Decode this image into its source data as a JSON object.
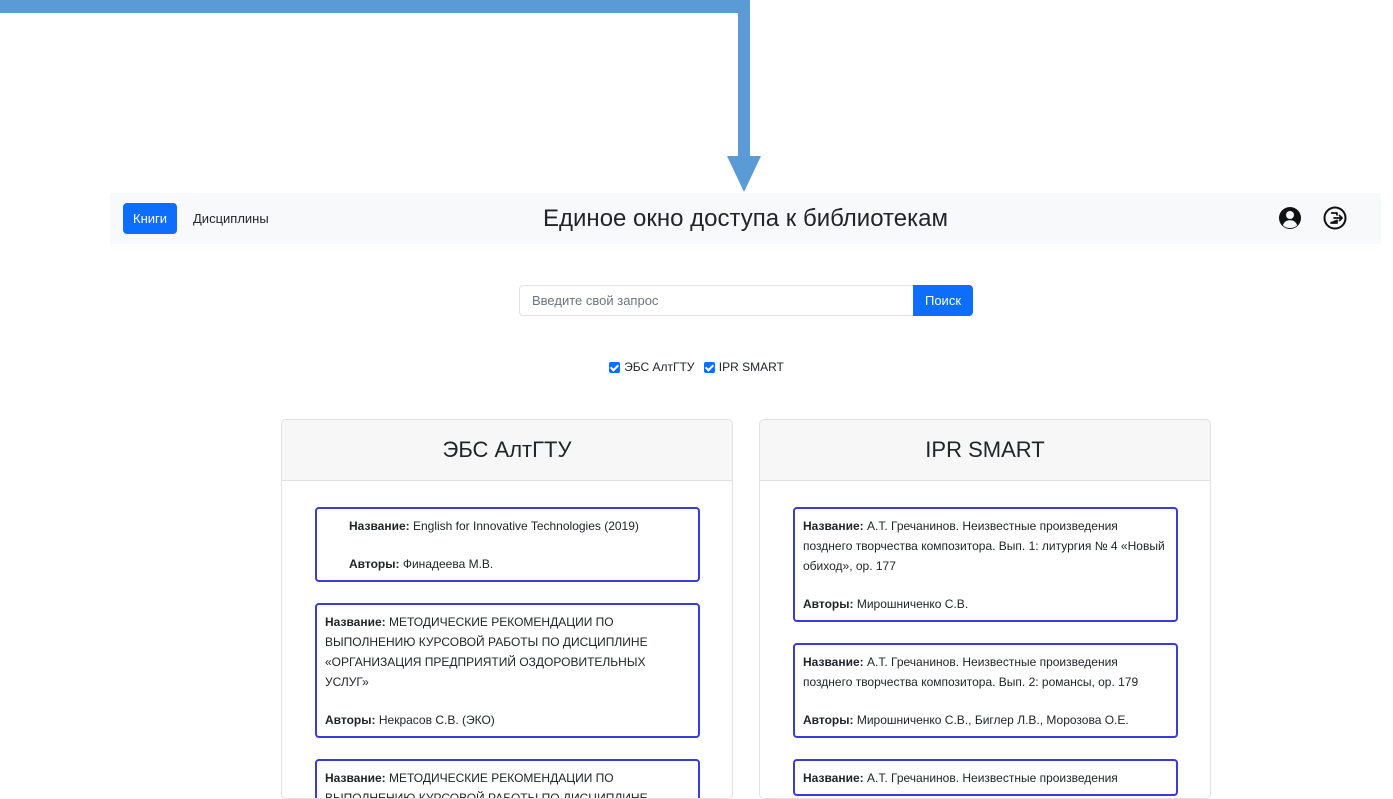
{
  "navbar": {
    "tabs": [
      {
        "label": "Книги",
        "active": true
      },
      {
        "label": "Дисциплины",
        "active": false
      }
    ],
    "title": "Единое окно доступа к библиотекам",
    "icons": [
      "user-circle-icon",
      "logout-icon"
    ]
  },
  "search": {
    "placeholder": "Введите свой запрос",
    "value": "",
    "button_label": "Поиск"
  },
  "filters": [
    {
      "label": "ЭБС АлтГТУ",
      "checked": true
    },
    {
      "label": "IPR SMART",
      "checked": true
    }
  ],
  "labels": {
    "name": "Название:",
    "authors": "Авторы:"
  },
  "columns": [
    {
      "title": "ЭБС АлтГТУ",
      "items": [
        {
          "name": "English for Innovative Technologies (2019)",
          "authors": "Финадеева М.В."
        },
        {
          "name": "МЕТОДИЧЕСКИЕ РЕКОМЕНДАЦИИ ПО ВЫПОЛНЕНИЮ КУРСОВОЙ РАБОТЫ ПО ДИСЦИПЛИНЕ «ОРГАНИЗАЦИЯ ПРЕДПРИЯТИЙ ОЗДОРОВИТЕЛЬНЫХ УСЛУГ»",
          "authors": "Некрасов С.В. (ЭКО)"
        },
        {
          "name": "МЕТОДИЧЕСКИЕ РЕКОМЕНДАЦИИ ПО ВЫПОЛНЕНИЮ КУРСОВОЙ РАБОТЫ ПО ДИСЦИПЛИНЕ",
          "authors": ""
        }
      ]
    },
    {
      "title": "IPR SMART",
      "items": [
        {
          "name": "А.Т. Гречанинов. Неизвестные произведения позднего творчества композитора. Вып. 1: литургия № 4 «Новый обиход», ор. 177",
          "authors": "Мирошниченко С.В."
        },
        {
          "name": "А.Т. Гречанинов. Неизвестные произведения позднего творчества композитора. Вып. 2: романсы, ор. 179",
          "authors": "Мирошниченко С.В., Биглер Л.В., Морозова О.Е."
        },
        {
          "name": "А.Т. Гречанинов. Неизвестные произведения",
          "authors": ""
        }
      ]
    }
  ],
  "colors": {
    "primary": "#0d6efd",
    "card_border": "#3b3bdc",
    "arrow": "#5b9bd5",
    "navbar_bg": "#f8f9fa"
  }
}
